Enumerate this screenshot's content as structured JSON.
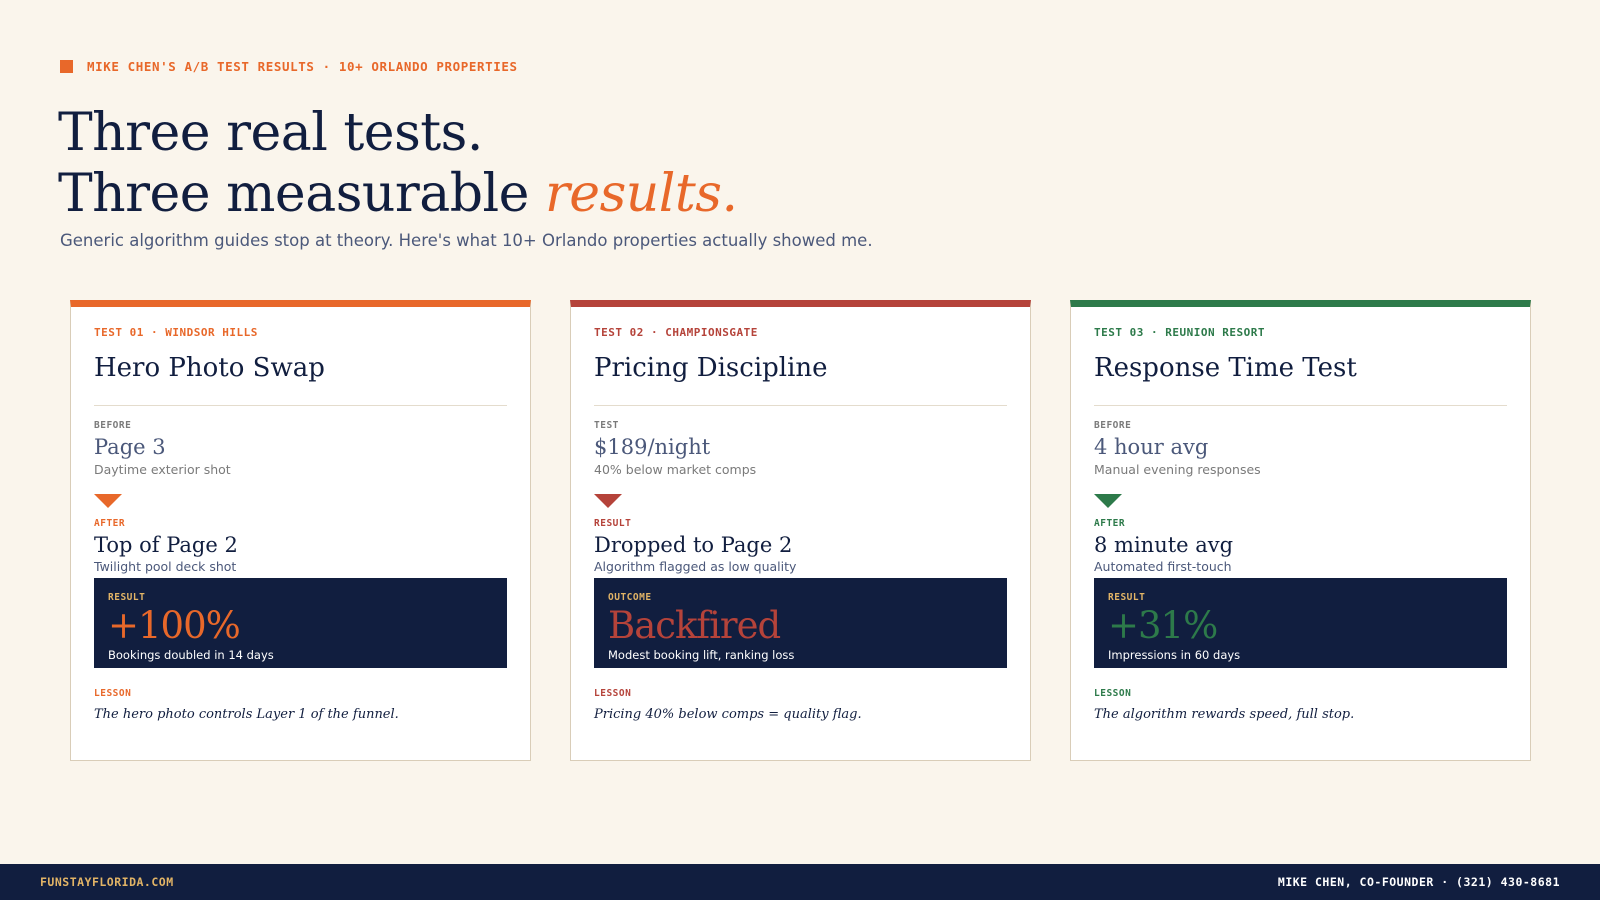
{
  "eyebrow": "MIKE CHEN'S A/B TEST RESULTS · 10+ ORLANDO PROPERTIES",
  "headline": {
    "line1": "Three real tests.",
    "line2_prefix": "Three measurable ",
    "line2_accent": "results."
  },
  "subtitle": "Generic algorithm guides stop at theory. Here's what 10+ Orlando properties actually showed me.",
  "colors": {
    "background": "#faf5ec",
    "navy": "#111e3f",
    "orange": "#e8682a",
    "red": "#b5433a",
    "green": "#2d7a4a",
    "gold": "#e2b466"
  },
  "cards": [
    {
      "accent": "#e8682a",
      "tag": "TEST 01 · WINDSOR HILLS",
      "title": "Hero Photo Swap",
      "before_label": "BEFORE",
      "before_value": "Page 3",
      "before_sub": "Daytime exterior shot",
      "arrow_icon": "arrow-down-icon",
      "after_label": "AFTER",
      "after_value": "Top of Page 2",
      "after_sub": "Twilight pool deck shot",
      "result_label": "RESULT",
      "result_value": "+100%",
      "result_sub": "Bookings doubled in 14 days",
      "lesson_label": "LESSON",
      "lesson_text": "The hero photo controls Layer 1 of the funnel."
    },
    {
      "accent": "#b5433a",
      "tag": "TEST 02 · CHAMPIONSGATE",
      "title": "Pricing Discipline",
      "before_label": "TEST",
      "before_value": "$189/night",
      "before_sub": "40% below market comps",
      "arrow_icon": "arrow-down-icon",
      "after_label": "RESULT",
      "after_value": "Dropped to Page 2",
      "after_sub": "Algorithm flagged as low quality",
      "result_label": "OUTCOME",
      "result_value": "Backfired",
      "result_sub": "Modest booking lift, ranking loss",
      "lesson_label": "LESSON",
      "lesson_text": "Pricing 40% below comps = quality flag."
    },
    {
      "accent": "#2d7a4a",
      "tag": "TEST 03 · REUNION RESORT",
      "title": "Response Time Test",
      "before_label": "BEFORE",
      "before_value": "4 hour avg",
      "before_sub": "Manual evening responses",
      "arrow_icon": "arrow-down-icon",
      "after_label": "AFTER",
      "after_value": "8 minute avg",
      "after_sub": "Automated first-touch",
      "result_label": "RESULT",
      "result_value": "+31%",
      "result_sub": "Impressions in 60 days",
      "lesson_label": "LESSON",
      "lesson_text": "The algorithm rewards speed, full stop."
    }
  ],
  "footer": {
    "site": "FUNSTAYFLORIDA.COM",
    "contact": "MIKE CHEN, CO-FOUNDER · (321) 430-8681"
  }
}
